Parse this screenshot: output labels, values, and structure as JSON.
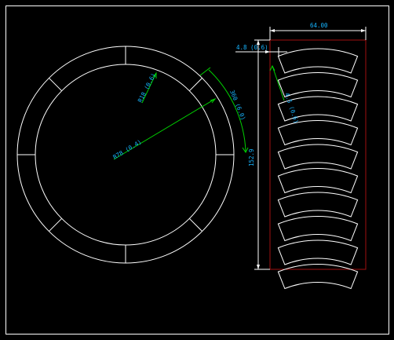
{
  "colors": {
    "background": "#000000",
    "geometry": "#ffffff",
    "dimension_line": "#00d200",
    "dimension_text": "#16b4ff",
    "sheet_boundary": "#a01010"
  },
  "dimensions": {
    "width_label": "64.00",
    "strip_offset_label": "4.8 (0.6)",
    "height_label": "152.9",
    "angle_label": "360 (6.0)",
    "inner_radius_label": "R78 (0.4)",
    "ring_width_label": "R18 (0.6)",
    "segment_gap_label": "4.5 (0.6)"
  },
  "ring": {
    "segment_count": 8,
    "divider_angles_deg": [
      0,
      45,
      90,
      135,
      180,
      225,
      270,
      315
    ]
  },
  "nested_segments": {
    "count": 10
  }
}
